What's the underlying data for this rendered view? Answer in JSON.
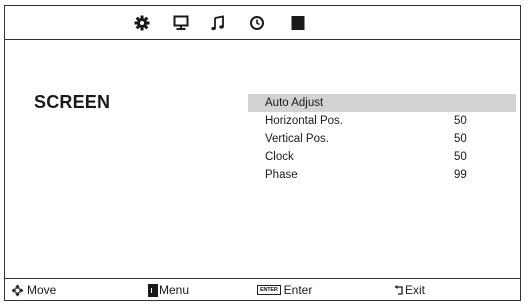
{
  "tabs": [
    {
      "icon": "gear-icon"
    },
    {
      "icon": "monitor-icon"
    },
    {
      "icon": "music-note-icon"
    },
    {
      "icon": "clock-icon"
    },
    {
      "icon": "lock-icon"
    }
  ],
  "screen": {
    "title": "SCREEN",
    "items": [
      {
        "label": "Auto Adjust",
        "value": ""
      },
      {
        "label": "Horizontal Pos.",
        "value": "50"
      },
      {
        "label": "Vertical Pos.",
        "value": "50"
      },
      {
        "label": "Clock",
        "value": "50"
      },
      {
        "label": "Phase",
        "value": "99"
      }
    ],
    "selected_index": 0
  },
  "footer": {
    "move_label": "Move",
    "menu_label": "Menu",
    "enter_key_label": "ENTER",
    "enter_label": "Enter",
    "exit_label": "Exit"
  },
  "colors": {
    "border": "#333333",
    "highlight": "#d3d3d3",
    "text": "#1a1a1a"
  }
}
